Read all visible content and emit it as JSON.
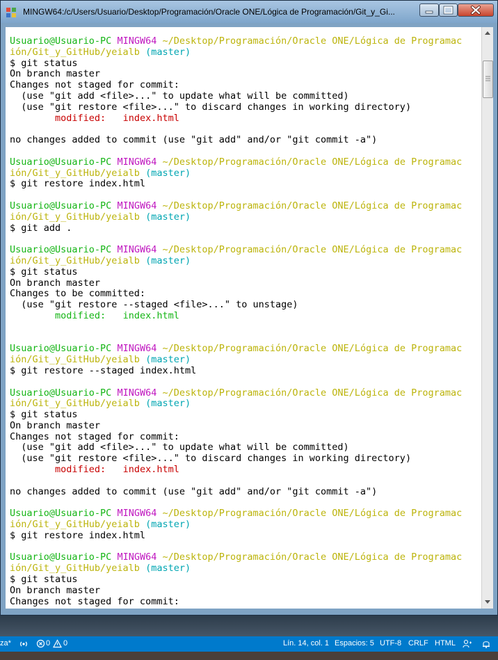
{
  "window": {
    "title": "MINGW64:/c/Users/Usuario/Desktop/Programación/Oracle ONE/Lógica de Programación/Git_y_Gi..."
  },
  "terminal": {
    "lines": [
      [
        [
          "u",
          "Usuario@Usuario-PC "
        ],
        [
          "m",
          "MINGW64 "
        ],
        [
          "p",
          "~/Desktop/Programación/Oracle ONE/Lógica de Programac"
        ]
      ],
      [
        [
          "p",
          "ión/Git_y_GitHub/yeialb "
        ],
        [
          "b",
          "(master)"
        ]
      ],
      [
        [
          "t",
          "$ git status"
        ]
      ],
      [
        [
          "t",
          "On branch master"
        ]
      ],
      [
        [
          "t",
          "Changes not staged for commit:"
        ]
      ],
      [
        [
          "t",
          "  (use \"git add <file>...\" to update what will be committed)"
        ]
      ],
      [
        [
          "t",
          "  (use \"git restore <file>...\" to discard changes in working directory)"
        ]
      ],
      [
        [
          "t",
          "        "
        ],
        [
          "r",
          "modified:   index.html"
        ]
      ],
      [],
      [
        [
          "t",
          "no changes added to commit (use \"git add\" and/or \"git commit -a\")"
        ]
      ],
      [],
      [
        [
          "u",
          "Usuario@Usuario-PC "
        ],
        [
          "m",
          "MINGW64 "
        ],
        [
          "p",
          "~/Desktop/Programación/Oracle ONE/Lógica de Programac"
        ]
      ],
      [
        [
          "p",
          "ión/Git_y_GitHub/yeialb "
        ],
        [
          "b",
          "(master)"
        ]
      ],
      [
        [
          "t",
          "$ git restore index.html"
        ]
      ],
      [],
      [
        [
          "u",
          "Usuario@Usuario-PC "
        ],
        [
          "m",
          "MINGW64 "
        ],
        [
          "p",
          "~/Desktop/Programación/Oracle ONE/Lógica de Programac"
        ]
      ],
      [
        [
          "p",
          "ión/Git_y_GitHub/yeialb "
        ],
        [
          "b",
          "(master)"
        ]
      ],
      [
        [
          "t",
          "$ git add ."
        ]
      ],
      [],
      [
        [
          "u",
          "Usuario@Usuario-PC "
        ],
        [
          "m",
          "MINGW64 "
        ],
        [
          "p",
          "~/Desktop/Programación/Oracle ONE/Lógica de Programac"
        ]
      ],
      [
        [
          "p",
          "ión/Git_y_GitHub/yeialb "
        ],
        [
          "b",
          "(master)"
        ]
      ],
      [
        [
          "t",
          "$ git status"
        ]
      ],
      [
        [
          "t",
          "On branch master"
        ]
      ],
      [
        [
          "t",
          "Changes to be committed:"
        ]
      ],
      [
        [
          "t",
          "  (use \"git restore --staged <file>...\" to unstage)"
        ]
      ],
      [
        [
          "t",
          "        "
        ],
        [
          "u",
          "modified:   index.html"
        ]
      ],
      [],
      [],
      [
        [
          "u",
          "Usuario@Usuario-PC "
        ],
        [
          "m",
          "MINGW64 "
        ],
        [
          "p",
          "~/Desktop/Programación/Oracle ONE/Lógica de Programac"
        ]
      ],
      [
        [
          "p",
          "ión/Git_y_GitHub/yeialb "
        ],
        [
          "b",
          "(master)"
        ]
      ],
      [
        [
          "t",
          "$ git restore --staged index.html"
        ]
      ],
      [],
      [
        [
          "u",
          "Usuario@Usuario-PC "
        ],
        [
          "m",
          "MINGW64 "
        ],
        [
          "p",
          "~/Desktop/Programación/Oracle ONE/Lógica de Programac"
        ]
      ],
      [
        [
          "p",
          "ión/Git_y_GitHub/yeialb "
        ],
        [
          "b",
          "(master)"
        ]
      ],
      [
        [
          "t",
          "$ git status"
        ]
      ],
      [
        [
          "t",
          "On branch master"
        ]
      ],
      [
        [
          "t",
          "Changes not staged for commit:"
        ]
      ],
      [
        [
          "t",
          "  (use \"git add <file>...\" to update what will be committed)"
        ]
      ],
      [
        [
          "t",
          "  (use \"git restore <file>...\" to discard changes in working directory)"
        ]
      ],
      [
        [
          "t",
          "        "
        ],
        [
          "r",
          "modified:   index.html"
        ]
      ],
      [],
      [
        [
          "t",
          "no changes added to commit (use \"git add\" and/or \"git commit -a\")"
        ]
      ],
      [],
      [
        [
          "u",
          "Usuario@Usuario-PC "
        ],
        [
          "m",
          "MINGW64 "
        ],
        [
          "p",
          "~/Desktop/Programación/Oracle ONE/Lógica de Programac"
        ]
      ],
      [
        [
          "p",
          "ión/Git_y_GitHub/yeialb "
        ],
        [
          "b",
          "(master)"
        ]
      ],
      [
        [
          "t",
          "$ git restore index.html"
        ]
      ],
      [],
      [
        [
          "u",
          "Usuario@Usuario-PC "
        ],
        [
          "m",
          "MINGW64 "
        ],
        [
          "p",
          "~/Desktop/Programación/Oracle ONE/Lógica de Programac"
        ]
      ],
      [
        [
          "p",
          "ión/Git_y_GitHub/yeialb "
        ],
        [
          "b",
          "(master)"
        ]
      ],
      [
        [
          "t",
          "$ git status"
        ]
      ],
      [
        [
          "t",
          "On branch master"
        ]
      ],
      [
        [
          "t",
          "Changes not staged for commit:"
        ]
      ]
    ]
  },
  "statusbar": {
    "branch_fragment": "za*",
    "errors": "0",
    "warnings": "0",
    "position": "Lín. 14, col. 1",
    "spaces": "Espacios: 5",
    "encoding": "UTF-8",
    "eol": "CRLF",
    "language": "HTML"
  },
  "colors": {
    "user_host": "#15b515",
    "mingw": "#c018c0",
    "path": "#bcb40c",
    "branch": "#00a6b2",
    "modified_unstaged": "#c80000",
    "statusbar_bg": "#007acc"
  },
  "icons": [
    "app-icon",
    "minimize-icon",
    "maximize-icon",
    "close-icon",
    "scroll-up-arrow-icon",
    "scroll-down-arrow-icon",
    "broadcast-icon",
    "error-icon",
    "warning-icon",
    "feedback-icon",
    "bell-icon"
  ]
}
